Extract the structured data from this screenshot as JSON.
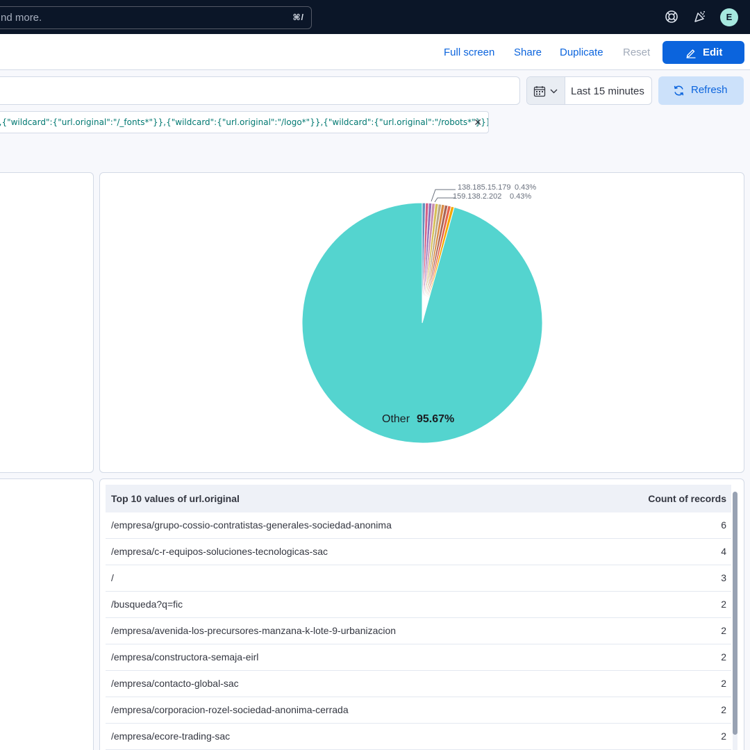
{
  "topbar": {
    "search_text": "nd more.",
    "search_shortcut": "⌘/",
    "avatar_initial": "E",
    "icons": [
      "help-icon",
      "news-icon"
    ]
  },
  "actions": {
    "full_screen": "Full screen",
    "share": "Share",
    "duplicate": "Duplicate",
    "reset": "Reset",
    "edit": "Edit"
  },
  "query": {
    "date_range": "Last 15 minutes",
    "refresh": "Refresh"
  },
  "filter": {
    "text": "},{\"wildcard\":{\"url.original\":\"/_fonts*\"}},{\"wildcard\":{\"url.original\":\"/logo*\"}},{\"wildcard\":{\"url.original\":\"/robots*\"}}]}}"
  },
  "pie": {
    "labels": [
      {
        "ip": "138.185.15.179",
        "pct": "0.43%"
      },
      {
        "ip": "159.138.2.202",
        "pct": "0.43%"
      }
    ],
    "other_label": "Other",
    "other_pct": "95.67%"
  },
  "chart_data": {
    "type": "pie",
    "slices": [
      {
        "name": "Other",
        "value": 95.67,
        "color": "#54d4cf"
      },
      {
        "name": "138.185.15.179",
        "value": 0.43,
        "color": "#6092c0"
      },
      {
        "name": "159.138.2.202",
        "value": 0.43,
        "color": "#d36086"
      },
      {
        "name": "",
        "value": 0.43,
        "color": "#9170b8"
      },
      {
        "name": "",
        "value": 0.43,
        "color": "#ca8eae"
      },
      {
        "name": "",
        "value": 0.43,
        "color": "#d6bf57"
      },
      {
        "name": "",
        "value": 0.43,
        "color": "#b9a888"
      },
      {
        "name": "",
        "value": 0.43,
        "color": "#da8b45"
      },
      {
        "name": "",
        "value": 0.43,
        "color": "#aa6556"
      },
      {
        "name": "",
        "value": 0.43,
        "color": "#e7664c"
      },
      {
        "name": "",
        "value": 0.43,
        "color": "#f5a700"
      }
    ]
  },
  "table": {
    "header_name": "Top 10 values of url.original",
    "header_count": "Count of records",
    "rows": [
      {
        "name": "/empresa/grupo-cossio-contratistas-generales-sociedad-anonima",
        "count": "6"
      },
      {
        "name": "/empresa/c-r-equipos-soluciones-tecnologicas-sac",
        "count": "4"
      },
      {
        "name": "/",
        "count": "3"
      },
      {
        "name": "/busqueda?q=fic",
        "count": "2"
      },
      {
        "name": "/empresa/avenida-los-precursores-manzana-k-lote-9-urbanizacion",
        "count": "2"
      },
      {
        "name": "/empresa/constructora-semaja-eirl",
        "count": "2"
      },
      {
        "name": "/empresa/contacto-global-sac",
        "count": "2"
      },
      {
        "name": "/empresa/corporacion-rozel-sociedad-anonima-cerrada",
        "count": "2"
      },
      {
        "name": "/empresa/ecore-trading-sac",
        "count": "2"
      }
    ]
  }
}
